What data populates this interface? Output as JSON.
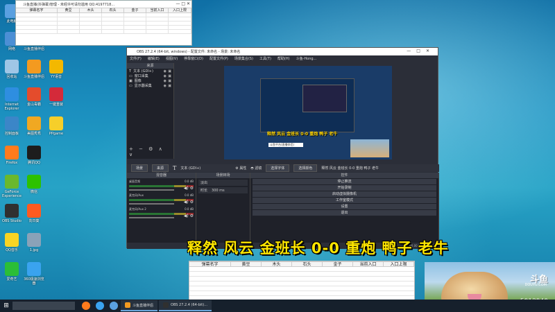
{
  "desktop_icons": [
    {
      "label": "此电脑",
      "color": "#5aa0e0",
      "pos": "a"
    },
    {
      "label": "网络",
      "color": "#4c8fd5",
      "pos": "b"
    },
    {
      "label": "斗鱼直播伴侣",
      "color": "#f08a1c",
      "pos": "c"
    },
    {
      "label": "回收站",
      "color": "#9fc6e6",
      "pos": "d"
    },
    {
      "label": "斗鱼直播伴侣",
      "color": "#f39a20",
      "pos": "e"
    },
    {
      "label": "YY语音",
      "color": "#f3b800",
      "pos": "f"
    },
    {
      "label": "Internet Explorer",
      "color": "#2e8ee0",
      "pos": "g"
    },
    {
      "label": "金山毒霸",
      "color": "#e44c2c",
      "pos": "h"
    },
    {
      "label": "一键重装",
      "color": "#d42a3a",
      "pos": "i"
    },
    {
      "label": "控制面板",
      "color": "#3b86c8",
      "pos": "j"
    },
    {
      "label": "美图秀秀",
      "color": "#f0a822",
      "pos": "k"
    },
    {
      "label": "PPgame",
      "color": "#f6cf2a",
      "pos": "l"
    },
    {
      "label": "Firefox",
      "color": "#ff7b1c",
      "pos": "m"
    },
    {
      "label": "腾讯QQ",
      "color": "#1d1d1d",
      "pos": "n"
    },
    {
      "label": "GeForce Experience",
      "color": "#6ab82d",
      "pos": "o"
    },
    {
      "label": "微信",
      "color": "#2dc100",
      "pos": "p"
    },
    {
      "label": "OBS Studio",
      "color": "#303030",
      "pos": "q"
    },
    {
      "label": "向日葵",
      "color": "#ff5a1f",
      "pos": "r"
    },
    {
      "label": "QQ音乐",
      "color": "#f9d423",
      "pos": "s"
    },
    {
      "label": "1.jpg",
      "color": "#8aa2b8",
      "pos": "t"
    },
    {
      "label": "爱奇艺",
      "color": "#2bbe37",
      "pos": "u"
    },
    {
      "label": "360极速浏览器",
      "color": "#3aa3ef",
      "pos": "v"
    }
  ],
  "top_sheet": {
    "title": "斗鱼直播(抖弹幕)管理 - 未经许可请勿滥用 QQ:4197718...",
    "window_buttons": "—  □  ✕",
    "columns": [
      "弹幕名字",
      "黄豆",
      "木头",
      "石头",
      "金子",
      "当前入口",
      "入口上限"
    ]
  },
  "obs": {
    "title": "OBS 27.2.4 (64-bit, windows) - 配置文件: 未命名 - 场景: 未命名",
    "window_buttons": "—□✕",
    "menu": [
      "文件(F)",
      "编辑(E)",
      "视图(V)",
      "停靠窗口(D)",
      "配置文件(P)",
      "场景集合(S)",
      "工具(T)",
      "帮助(H)",
      "斗鱼-Hong..."
    ],
    "sources_header": "来源",
    "sources": [
      {
        "icon": "T",
        "label": "文本 (GDI+)"
      },
      {
        "icon": "▭",
        "label": "窗口采集"
      },
      {
        "icon": "▣",
        "label": "图像"
      },
      {
        "icon": "▭",
        "label": "显示器采集"
      }
    ],
    "src_tools": "+ − ⚙ ∧ ∨",
    "preview_caption": "释然 风云 金班长 0-0 重炮 鸭子 老牛",
    "preview_chip": "斗鱼平台(直播伴侣)",
    "ctrlbar": {
      "scene_label": "场景",
      "source_label": "来源",
      "text_icon": "T",
      "text_source": "文本 (GDI+)",
      "props": "⚙ 属性",
      "filters": "◓ 滤镜",
      "select_font": "选择字体",
      "select_color": "选择颜色",
      "marquee": "释然 风云 金班长 0-0 重炮 鸭子 老牛"
    },
    "mixer_header": "混音器",
    "mixer": [
      {
        "name": "桌面音频",
        "db": "0.0 dB"
      },
      {
        "name": "麦克风/Aux",
        "db": "0.0 dB"
      },
      {
        "name": "麦克风/Aux 2",
        "db": "0.0 dB"
      }
    ],
    "transitions_header": "场景转场",
    "transition": "淡出",
    "duration_label": "时长",
    "duration_value": "300 ms",
    "controls_header": "控件",
    "controls": [
      "停止推流",
      "开始录制",
      "启动虚拟摄像机",
      "工作室模式",
      "设置",
      "退出"
    ],
    "status": "60.00 fps"
  },
  "caption": "释然 风云 金班长 0-0 重炮 鸭子 老牛",
  "bottom_sheet": {
    "columns": [
      "弹幕名字",
      "黄豆",
      "木头",
      "石头",
      "金子",
      "当前入口",
      "入口上限"
    ]
  },
  "webcam": {
    "logo": "斗鱼",
    "logo_sub": "DOUYU.COM",
    "room_id": "5913940"
  },
  "taskbar": {
    "start": "⊞",
    "items": [
      {
        "label": "斗鱼直播伴侣",
        "color": "#f39a20"
      },
      {
        "label": "OBS 27.2.4 (64-bit)...",
        "color": "#303030"
      }
    ]
  },
  "colors": {
    "obs_bg": "#2b2e38",
    "caption": "#ffe600"
  }
}
